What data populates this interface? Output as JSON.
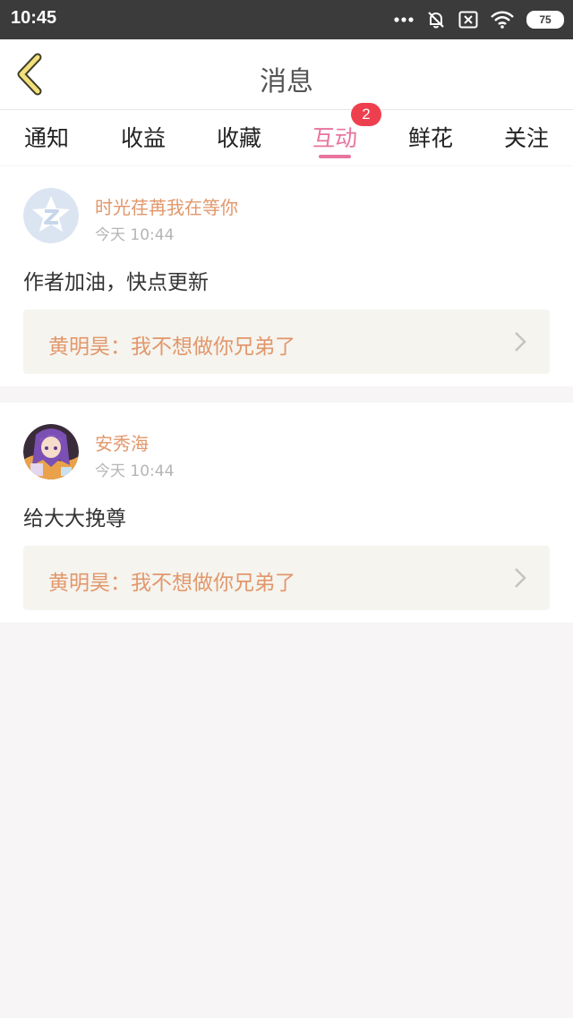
{
  "status_bar": {
    "time": "10:45",
    "battery": "75",
    "icons": [
      "more-dots-icon",
      "bell-off-icon",
      "sim-x-icon",
      "wifi-icon",
      "battery-icon"
    ]
  },
  "header": {
    "title": "消息",
    "back_icon": "chevron-left-icon"
  },
  "tabs": [
    {
      "label": "通知"
    },
    {
      "label": "收益"
    },
    {
      "label": "收藏"
    },
    {
      "label": "互动",
      "active": true,
      "badge": "2"
    },
    {
      "label": "鲜花"
    },
    {
      "label": "关注"
    }
  ],
  "messages": [
    {
      "username": "时光荏苒我在等你",
      "time": "今天 10:44",
      "comment": "作者加油，快点更新",
      "reply": "黄明昊：我不想做你兄弟了",
      "avatar": "default-avatar-icon"
    },
    {
      "username": "安秀海",
      "time": "今天 10:44",
      "comment": "给大大挽尊",
      "reply": "黄明昊：我不想做你兄弟了",
      "avatar": "anime-avatar"
    }
  ],
  "colors": {
    "accent": "#e8749e",
    "username": "#e2976b",
    "badge": "#ee3f4f",
    "reply_bg": "#f5f4ef"
  }
}
